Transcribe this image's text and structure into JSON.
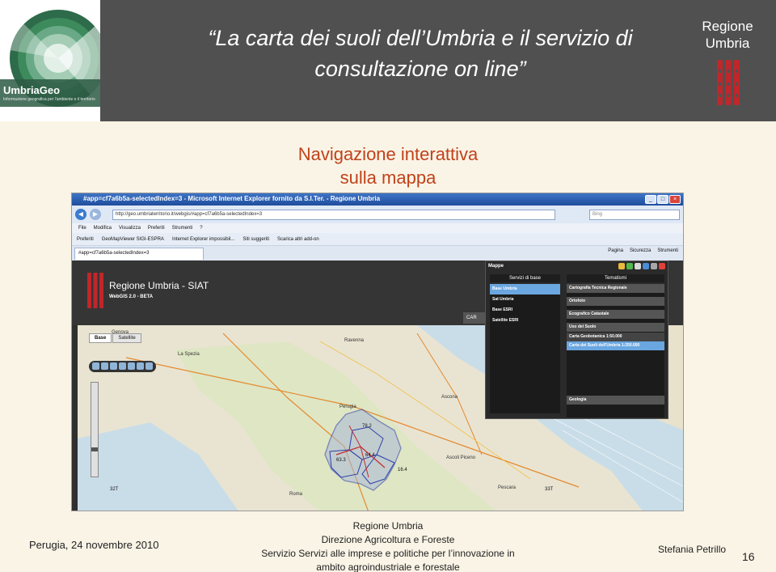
{
  "header": {
    "logo_name": "UmbriaGeo",
    "logo_tagline": "Informazione geografica per l'ambiente e il territorio",
    "title_line1": "“La carta dei suoli dell’Umbria e il servizio di",
    "title_line2": "consultazione on line”",
    "region_line1": "Regione",
    "region_line2": "Umbria",
    "emblem_icon": "umbria-emblem-icon",
    "emblem_color": "#c0262b"
  },
  "slide": {
    "subtitle_line1": "Navigazione interattiva",
    "subtitle_line2": "sulla mappa",
    "subtitle_color": "#c0421a"
  },
  "browser": {
    "window_title": "#app=cf7a6b5a-selectedIndex=3 - Microsoft Internet Explorer fornito da S.I.Ter. - Regione Umbria",
    "url": "http://geo.umbriaterritorio.it/webgis/#app=cf7a6b5a-selectedIndex=3",
    "search_placeholder": "Bing",
    "menu": [
      "File",
      "Modifica",
      "Visualizza",
      "Preferiti",
      "Strumenti",
      "?"
    ],
    "favorites": [
      "Preferiti",
      "GeoMapViewer SIGI-ESPRA",
      "Internet Explorer impossibil...",
      "Siti suggeriti",
      "Scarica altri add-on"
    ],
    "tab_label": "#app=cf7a6b5a-selectedIndex=3",
    "tools": [
      "Pagina",
      "Sicurezza",
      "Strumenti"
    ]
  },
  "app": {
    "name": "Regione Umbria - SIAT",
    "version": "WebGIS 2.0 - BETA",
    "carto_label": "CAR",
    "map_tabs": [
      "Base",
      "Satellite"
    ],
    "map_labels": [
      "Genova",
      "La Spezia",
      "Ravenna",
      "Ascona",
      "Ascoli Piceno",
      "Pescara",
      "Roma",
      "Perugia"
    ],
    "map_numbers": [
      "78.2",
      "64.4",
      "63.3",
      "16.4",
      "32T",
      "33T"
    ]
  },
  "layer_panel": {
    "title": "Mappe",
    "base_heading": "Servizi di base",
    "theme_heading": "Tematismi",
    "base_items": [
      {
        "label": "Base Umbria",
        "selected": true
      },
      {
        "label": "Sat Umbria",
        "selected": false
      },
      {
        "label": "Base ESRI",
        "selected": false
      },
      {
        "label": "Satellite ESRI",
        "selected": false
      }
    ],
    "theme_items": [
      "Cartografia Tecnica Regionale",
      "Ortofoto",
      "Ecografico Catastale",
      "Uso del Suolo"
    ],
    "soil_items": [
      {
        "label": "Carta Geobotanica 1:50.000",
        "selected": false
      },
      {
        "label": "Carta dei Suoli dell'Umbria 1:250.000",
        "selected": true
      }
    ],
    "geology_item": "Geologia"
  },
  "footer": {
    "date": "Perugia, 24 novembre 2010",
    "org_line1": "Regione Umbria",
    "org_line2": "Direzione Agricoltura e Foreste",
    "org_line3": "Servizio Servizi alle imprese e politiche per l’innovazione in",
    "org_line4": "ambito agroindustriale e forestale",
    "author": "Stefania Petrillo",
    "page_number": "16"
  }
}
